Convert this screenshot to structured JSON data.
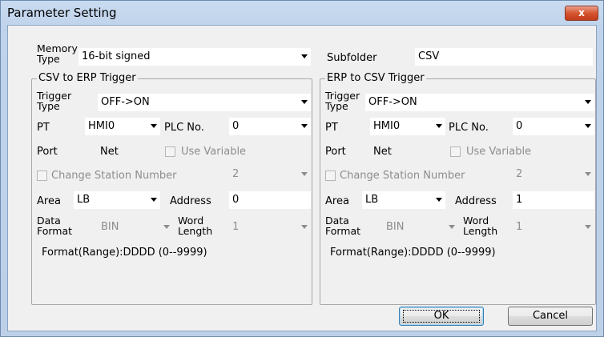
{
  "window": {
    "title": "Parameter Setting",
    "close_label": "x"
  },
  "memory_type": {
    "label": "Memory\nType",
    "label_l1": "Memory",
    "label_l2": "Type",
    "value": "16-bit signed"
  },
  "subfolder": {
    "label": "Subfolder",
    "value": "CSV"
  },
  "csv_to_erp": {
    "title": "CSV to ERP Trigger",
    "trigger_type_l1": "Trigger",
    "trigger_type_l2": "Type",
    "trigger_type": "OFF->ON",
    "pt_label": "PT",
    "pt": "HMI0",
    "plc_label": "PLC No.",
    "plc": "0",
    "port_label": "Port",
    "port": "Net",
    "use_variable": "Use Variable",
    "change_station": "Change Station Number",
    "station": "2",
    "area_label": "Area",
    "area": "LB",
    "address_label": "Address",
    "address": "0",
    "data_format_l1": "Data",
    "data_format_l2": "Format",
    "data_format": "BIN",
    "word_length_l1": "Word",
    "word_length_l2": "Length",
    "word_length": "1",
    "format_range": "Format(Range):DDDD (0--9999)"
  },
  "erp_to_csv": {
    "title": "ERP to CSV Trigger",
    "trigger_type_l1": "Trigger",
    "trigger_type_l2": "Type",
    "trigger_type": "OFF->ON",
    "pt_label": "PT",
    "pt": "HMI0",
    "plc_label": "PLC No.",
    "plc": "0",
    "port_label": "Port",
    "port": "Net",
    "use_variable": "Use Variable",
    "change_station": "Change Station Number",
    "station": "2",
    "area_label": "Area",
    "area": "LB",
    "address_label": "Address",
    "address": "1",
    "data_format_l1": "Data",
    "data_format_l2": "Format",
    "data_format": "BIN",
    "word_length_l1": "Word",
    "word_length_l2": "Length",
    "word_length": "1",
    "format_range": "Format(Range):DDDD (0--9999)"
  },
  "buttons": {
    "ok": "OK",
    "cancel": "Cancel"
  },
  "icons": {
    "close": "close-icon",
    "dropdown": "chevron-down-icon",
    "checkbox": "checkbox-unchecked"
  }
}
